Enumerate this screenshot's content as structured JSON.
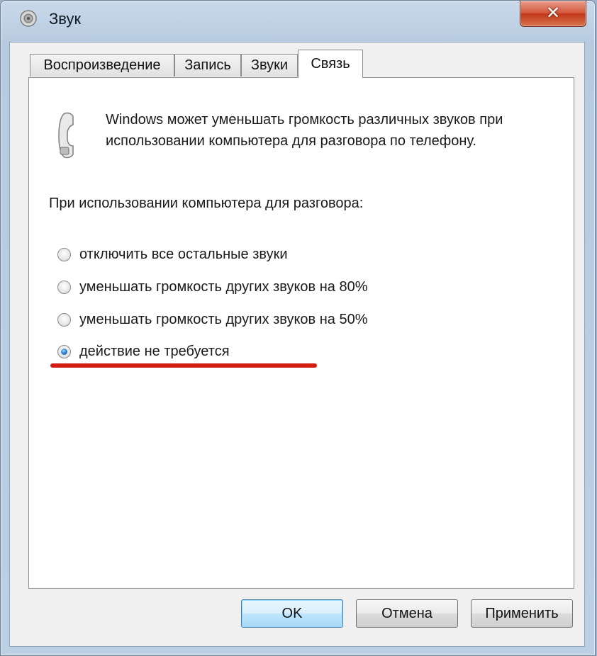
{
  "window": {
    "title": "Звук",
    "close_label": "✕"
  },
  "tabs": [
    {
      "label": "Воспроизведение",
      "active": false
    },
    {
      "label": "Запись",
      "active": false
    },
    {
      "label": "Звуки",
      "active": false
    },
    {
      "label": "Связь",
      "active": true
    }
  ],
  "panel": {
    "description": "Windows может уменьшать громкость различных звуков при использовании компьютера для разговора по телефону.",
    "prompt": "При использовании компьютера для разговора:",
    "options": [
      {
        "label": "отключить все остальные звуки",
        "checked": false
      },
      {
        "label": "уменьшать громкость других звуков на 80%",
        "checked": false
      },
      {
        "label": "уменьшать громкость других звуков на 50%",
        "checked": false
      },
      {
        "label": "действие не требуется",
        "checked": true
      }
    ],
    "highlight_color": "#d31d12"
  },
  "buttons": {
    "ok": "OK",
    "cancel": "Отмена",
    "apply": "Применить"
  },
  "icons": {
    "app": "speaker-icon",
    "panel": "telephone-handset-icon"
  }
}
